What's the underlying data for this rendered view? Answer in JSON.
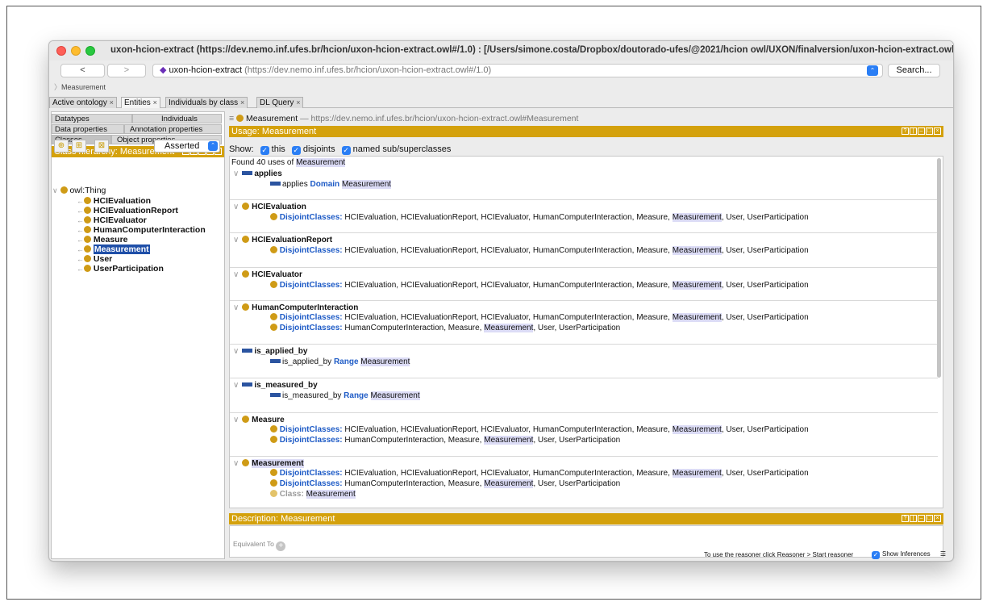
{
  "window": {
    "title": "uxon-hcion-extract (https://dev.nemo.inf.ufes.br/hcion/uxon-hcion-extract.owl#/1.0)  : [/Users/simone.costa/Dropbox/doutorado-ufes/@2021/hcion owl/UXON/finalversion/uxon-hcion-extract.owl]",
    "back_label": "<",
    "forward_label": ">",
    "url_name": "uxon-hcion-extract",
    "url_iri": "(https://dev.nemo.inf.ufes.br/hcion/uxon-hcion-extract.owl#/1.0)",
    "search_label": "Search...",
    "breadcrumb": "Measurement"
  },
  "tabs": [
    "Active ontology",
    "Entities",
    "Individuals by class",
    "DL Query"
  ],
  "tab_close": "×",
  "left": {
    "subtabs": [
      "Datatypes",
      "Individuals",
      "Data properties",
      "Annotation properties",
      "Classes",
      "Object properties"
    ],
    "hierarchy_title": "Class hierarchy: Measurement",
    "asserted_label": "Asserted",
    "root": "owl:Thing",
    "classes": [
      "HCIEvaluation",
      "HCIEvaluationReport",
      "HCIEvaluator",
      "HumanComputerInteraction",
      "Measure",
      "Measurement",
      "User",
      "UserParticipation"
    ],
    "selected": "Measurement"
  },
  "right": {
    "entity_name": "Measurement",
    "entity_iri": "— https://dev.nemo.inf.ufes.br/hcion/uxon-hcion-extract.owl#Measurement",
    "usage_title": "Usage: Measurement",
    "show_label": "Show:",
    "show_options": [
      "this",
      "disjoints",
      "named sub/superclasses"
    ],
    "found_prefix": "Found 40 uses of",
    "found_entity": "Measurement",
    "description_title": "Description: Measurement",
    "equivalent_label": "Equivalent To",
    "groups": {
      "applies": {
        "head": "applies",
        "row": {
          "a": "applies",
          "kw": "Domain",
          "b": "Measurement"
        }
      },
      "hcievaluation": {
        "head": "HCIEvaluation"
      },
      "hcievaluationreport": {
        "head": "HCIEvaluationReport"
      },
      "hcievaluator": {
        "head": "HCIEvaluator"
      },
      "hci": {
        "head": "HumanComputerInteraction"
      },
      "is_applied_by": {
        "head": "is_applied_by",
        "row": {
          "a": "is_applied_by",
          "kw": "Range",
          "b": "Measurement"
        }
      },
      "is_measured_by": {
        "head": "is_measured_by",
        "row": {
          "a": "is_measured_by",
          "kw": "Range",
          "b": "Measurement"
        }
      },
      "measure": {
        "head": "Measure"
      },
      "measurement": {
        "head": "Measurement",
        "class_kw": "Class:",
        "class_val": "Measurement"
      }
    },
    "axiom_kw": "DisjointClasses:",
    "axiom_long_a": "HCIEvaluation, HCIEvaluationReport, HCIEvaluator, HumanComputerInteraction, Measure,",
    "axiom_long_b": ", User, UserParticipation",
    "axiom_short_a": "HumanComputerInteraction, Measure,",
    "axiom_short_b": ", User, UserParticipation",
    "axiom_entity": "Measurement"
  },
  "status": {
    "message": "To use the reasoner click Reasoner > Start reasoner",
    "show_inferences": "Show Inferences"
  }
}
